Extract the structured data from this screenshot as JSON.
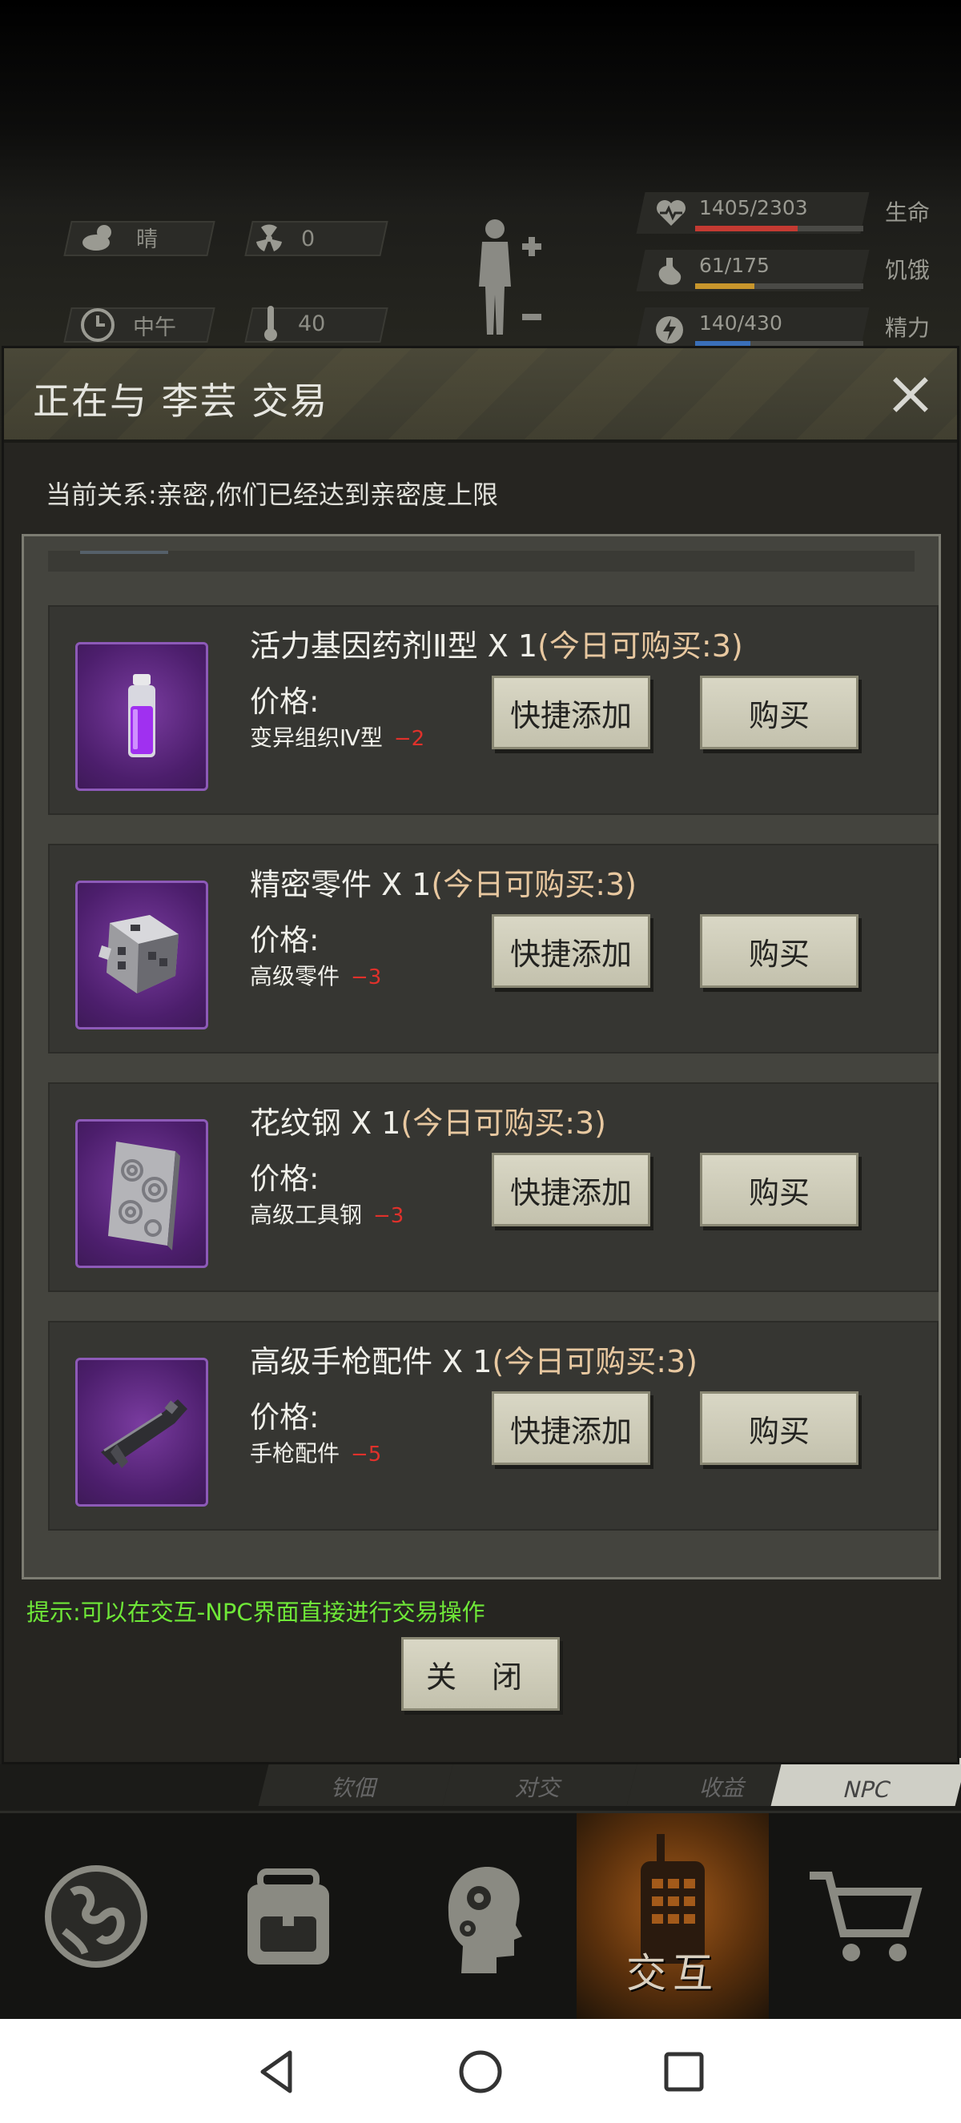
{
  "status": {
    "weather": "晴",
    "radiation": "0",
    "time_of_day": "中午",
    "temperature": "40",
    "vitals": [
      {
        "label": "生命",
        "value": "1405/2303",
        "fraction": 0.61,
        "color": "#c43a32",
        "icon": "heart-pulse-icon"
      },
      {
        "label": "饥饿",
        "value": "61/175",
        "fraction": 0.35,
        "color": "#c8962c",
        "icon": "stomach-icon"
      },
      {
        "label": "精力",
        "value": "140/430",
        "fraction": 0.33,
        "color": "#3a6fb8",
        "icon": "energy-icon"
      }
    ]
  },
  "dialog": {
    "title": "正在与 李芸 交易",
    "relation": "当前关系:亲密,你们已经达到亲密度上限",
    "hint": "提示:可以在交互-NPC界面直接进行交易操作",
    "close_label": "关 闭",
    "price_label": "价格:",
    "quick_add_label": "快捷添加",
    "buy_label": "购买",
    "items": [
      {
        "name": "活力基因药剂Ⅱ型 X 1",
        "limit": "(今日可购买:3)",
        "material": "变异组织Ⅳ型",
        "cost": "−2",
        "icon": "vial-icon"
      },
      {
        "name": "精密零件 X 1",
        "limit": "(今日可购买:3)",
        "material": "高级零件",
        "cost": "−3",
        "icon": "precision-parts-icon"
      },
      {
        "name": "花纹钢 X 1",
        "limit": "(今日可购买:3)",
        "material": "高级工具钢",
        "cost": "−3",
        "icon": "damascus-steel-icon"
      },
      {
        "name": "高级手枪配件 X 1",
        "limit": "(今日可购买:3)",
        "material": "手枪配件",
        "cost": "−5",
        "icon": "pistol-part-icon"
      }
    ]
  },
  "subtabs": [
    "钦佃",
    "对交",
    "收益",
    "NPC"
  ],
  "nav": {
    "tabs": [
      {
        "icon": "globe-icon"
      },
      {
        "icon": "backpack-icon"
      },
      {
        "icon": "head-gears-icon"
      },
      {
        "icon": "walkie-talkie-icon",
        "label": "交互",
        "active": true
      },
      {
        "icon": "shopping-cart-icon"
      }
    ]
  }
}
